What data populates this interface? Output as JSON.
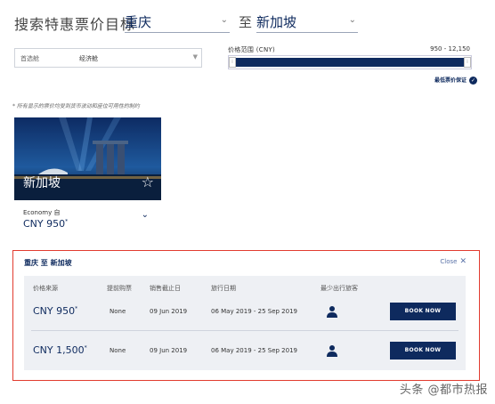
{
  "header": {
    "search_label": "搜索特惠票价目标",
    "origin": "重庆",
    "to_label": "至",
    "destination": "新加坡"
  },
  "filters": {
    "cabin_label": "首选舱",
    "cabin_value": "经济舱",
    "price_range_label": "价格范围 (CNY)",
    "price_min": "950",
    "price_max": "12,150",
    "price_separator": "-",
    "guarantee_label": "最低票价保证"
  },
  "note": "* 所有显示的票价均受到货币波动和座位可用性的制约",
  "card": {
    "city": "新加坡",
    "cabin": "Economy 自",
    "price": "CNY 950",
    "price_mark": "*"
  },
  "details": {
    "route": "重庆 至 新加坡",
    "close_label": "Close",
    "headers": [
      "价格来源",
      "提前购票",
      "销售截止日",
      "旅行日期",
      "最少出行旅客"
    ],
    "rows": [
      {
        "price": "CNY 950",
        "mark": "*",
        "advance": "None",
        "sale_end": "09 Jun 2019",
        "travel": "06 May 2019 - 25 Sep 2019",
        "button": "BOOK NOW"
      },
      {
        "price": "CNY 1,500",
        "mark": "*",
        "advance": "None",
        "sale_end": "09 Jun 2019",
        "travel": "06 May 2019 - 25 Sep 2019",
        "button": "BOOK NOW"
      }
    ]
  },
  "watermark": "头条 @都市热报",
  "colors": {
    "brand": "#0e2a5e",
    "highlight_border": "#e23b2f"
  },
  "icons": [
    "chevron-down-icon",
    "star-icon",
    "check-circle-icon",
    "close-icon",
    "person-icon"
  ]
}
